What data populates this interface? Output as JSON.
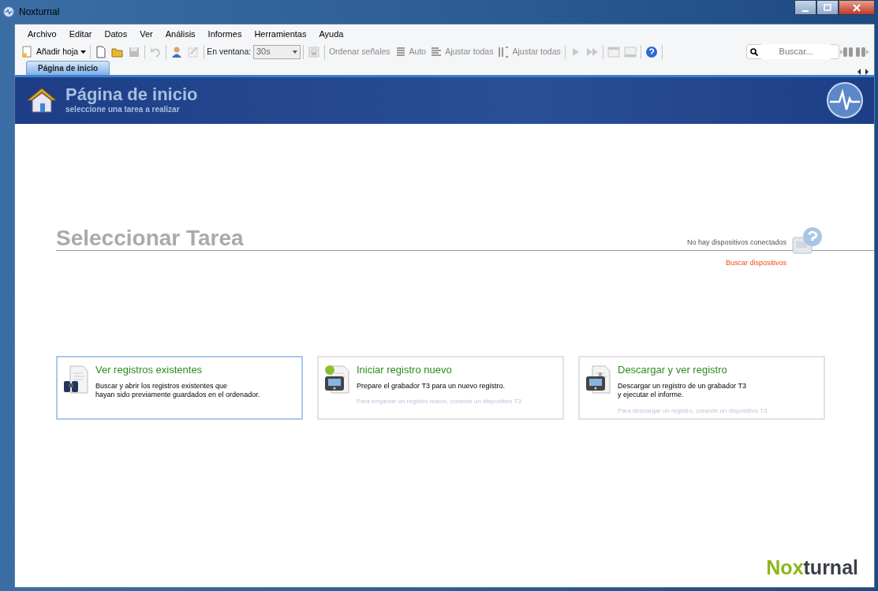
{
  "window": {
    "title": "Noxturnal"
  },
  "menu": [
    "Archivo",
    "Editar",
    "Datos",
    "Ver",
    "Análisis",
    "Informes",
    "Herramientas",
    "Ayuda"
  ],
  "toolbar": [
    {
      "kind": "dropdown",
      "label": "Añadir hoja",
      "disabled": false
    },
    {
      "kind": "sep"
    },
    {
      "kind": "icon",
      "disabled": false
    },
    {
      "kind": "icon",
      "disabled": false
    },
    {
      "kind": "icon",
      "disabled": true
    },
    {
      "kind": "sep"
    },
    {
      "kind": "icon",
      "disabled": true
    },
    {
      "kind": "sep"
    },
    {
      "kind": "icon",
      "disabled": false
    },
    {
      "kind": "icon",
      "disabled": true
    },
    {
      "kind": "sep"
    },
    {
      "kind": "combo",
      "label": "En ventana:",
      "value": "30s",
      "disabled": true
    },
    {
      "kind": "sep"
    },
    {
      "kind": "icon",
      "disabled": true
    },
    {
      "kind": "sep"
    },
    {
      "kind": "text",
      "label": "Ordenar señales",
      "disabled": true
    },
    {
      "kind": "labeled",
      "label": "Auto",
      "disabled": true
    },
    {
      "kind": "labeled",
      "label": "Ajustar todas",
      "disabled": true
    },
    {
      "kind": "labeled",
      "label": "Ajustar todas",
      "disabled": true
    },
    {
      "kind": "sep"
    },
    {
      "kind": "icon",
      "disabled": true
    },
    {
      "kind": "icon",
      "disabled": true
    },
    {
      "kind": "sep"
    },
    {
      "kind": "icon",
      "disabled": true
    },
    {
      "kind": "icon",
      "disabled": true
    },
    {
      "kind": "sep"
    },
    {
      "kind": "icon",
      "disabled": false
    },
    {
      "kind": "sep"
    }
  ],
  "search": {
    "placeholder": "Buscar..."
  },
  "tabs": [
    {
      "label": "Página de inicio",
      "selected": true
    }
  ],
  "header": {
    "title": "Página de inicio",
    "subtitle": "seleccione una tarea a realizar"
  },
  "section": {
    "title": "Seleccionar Tarea",
    "status": "No hay dispositivos conectados",
    "link": "Buscar dispositivos"
  },
  "tasks": [
    {
      "title": "Ver registros existentes",
      "description": "Buscar y abrir los registros existentes que\nhayan sido previamente guardados en el ordenador.",
      "selected": true
    },
    {
      "title": "Iniciar registro nuevo",
      "description": "Prepare el grabador T3 para un nuevo registro.",
      "hint": "Para empezar un registro nuevo, conecte un dispositivo T3",
      "selected": false
    },
    {
      "title": "Descargar y ver registro",
      "description": "Descargar un registro de un grabador T3\ny ejecutar el informe.",
      "hint": "Para descargar un registro, conecte un dispositivo T3",
      "selected": false
    }
  ],
  "logo": {
    "part_1": "Nox",
    "part_2": "turnal"
  }
}
